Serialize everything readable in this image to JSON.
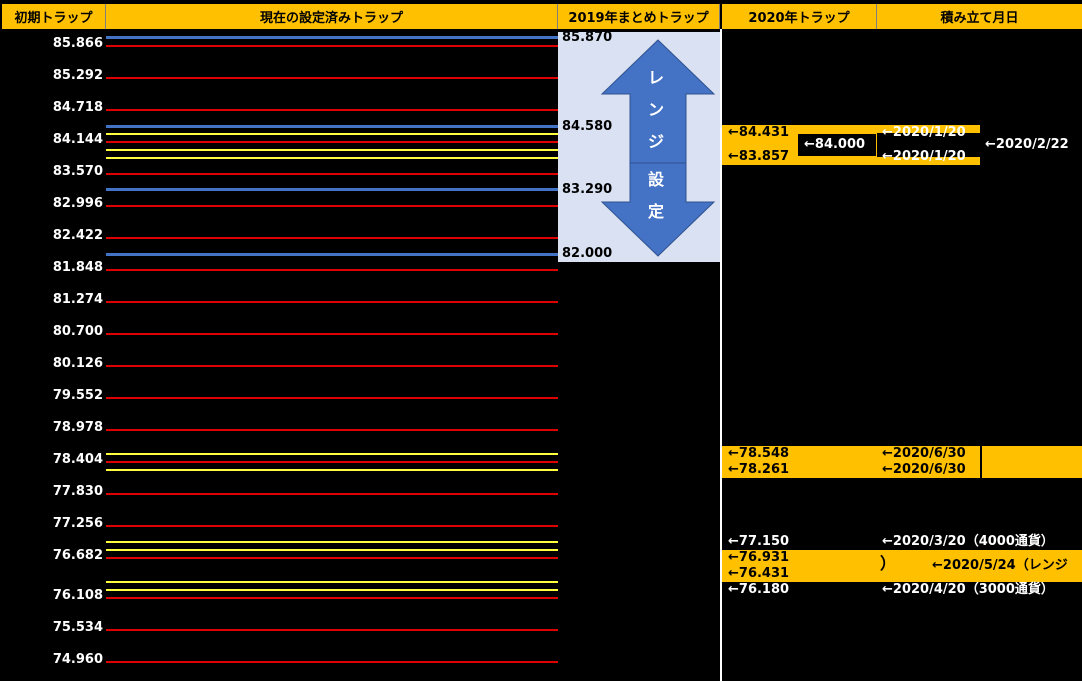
{
  "headers": [
    "初期トラップ",
    "現在の設定済みトラップ",
    "2019年まとめトラップ",
    "2020年トラップ",
    "積み立て月日"
  ],
  "initial_levels": [
    "85.866",
    "85.292",
    "84.718",
    "84.144",
    "83.570",
    "82.996",
    "82.422",
    "81.848",
    "81.274",
    "80.700",
    "80.126",
    "79.552",
    "78.978",
    "78.404",
    "77.830",
    "77.256",
    "76.682",
    "76.108",
    "75.534",
    "74.960"
  ],
  "range_2019": {
    "values": [
      "85.870",
      "84.580",
      "83.290",
      "82.000"
    ],
    "arrow_text": [
      "レ",
      "ン",
      "ジ",
      "設",
      "定"
    ]
  },
  "traps_2020": {
    "t1": "←84.431",
    "t2": "←83.857",
    "t_mid": "←84.000",
    "t3": "←78.548",
    "t4": "←78.261",
    "t5": "←77.150",
    "t6": "←76.931",
    "t7": "←76.431",
    "t8": "←76.180"
  },
  "dates": {
    "d1": "←2020/1/20",
    "d2": "←2020/1/20",
    "d_mid": "←2020/2/22",
    "d3": "←2020/6/30",
    "d4": "←2020/6/30",
    "d5": "←2020/3/20（4000通貨）",
    "d6": "←2020/5/24（レンジ",
    "d7": "←2020/4/20（3000通貨）",
    "bracket": "）"
  },
  "colors": {
    "header": "#ffc000",
    "trap_red": "#e00000",
    "trap_yellow": "#ffff40",
    "range_blue": "#4472c4",
    "range_bg": "#d9e1f2"
  }
}
